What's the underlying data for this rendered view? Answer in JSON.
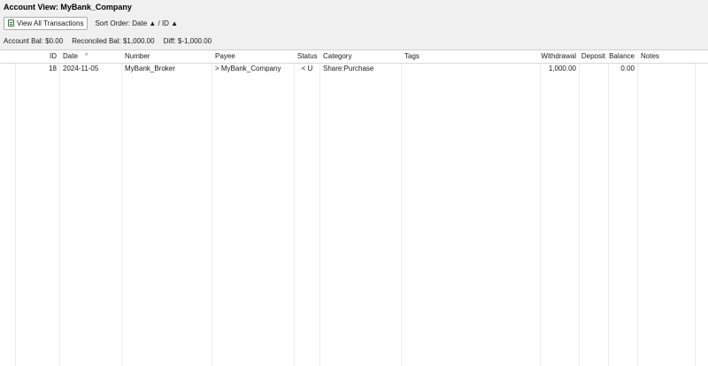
{
  "window": {
    "title": "Account View: MyBank_Company"
  },
  "toolbar": {
    "view_all_label": "View All Transactions",
    "view_all_icon": "ledger-icon",
    "sort_order": "Sort Order: Date ▲ / ID ▲"
  },
  "summary": {
    "account_bal": "Account Bal: $0.00",
    "reconciled_bal": "Reconciled Bal: $1,000.00",
    "diff": "Diff: $-1,000.00"
  },
  "table": {
    "sorted_column": "Date",
    "sort_indicator": "^",
    "columns": {
      "id": "ID",
      "date": "Date",
      "number": "Number",
      "payee": "Payee",
      "status": "Status",
      "category": "Category",
      "tags": "Tags",
      "withdrawal": "Withdrawal",
      "deposit": "Deposit",
      "balance": "Balance",
      "notes": "Notes"
    },
    "rows": [
      {
        "id": "18",
        "date": "2024-11-05",
        "number": "MyBank_Broker",
        "payee": "> MyBank_Company",
        "status": "< U",
        "category": "Share:Purchase",
        "tags": "",
        "withdrawal": "1,000.00",
        "deposit": "",
        "balance": "0.00",
        "notes": ""
      }
    ]
  }
}
